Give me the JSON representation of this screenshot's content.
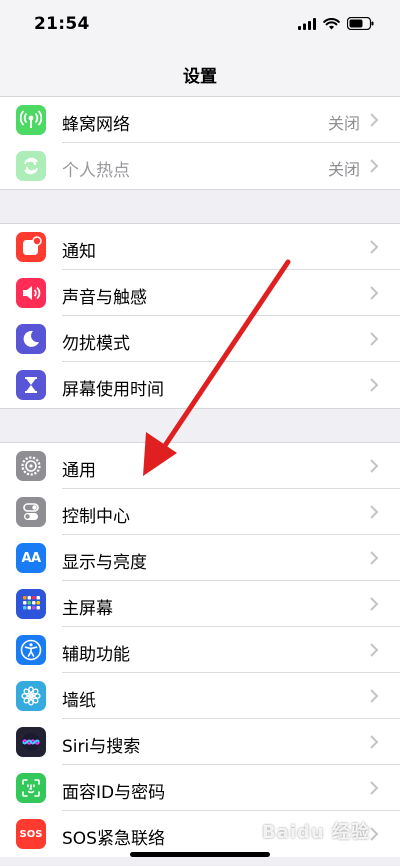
{
  "status": {
    "time": "21:54"
  },
  "nav": {
    "title": "设置"
  },
  "group1": [
    {
      "label": "蜂窝网络",
      "value": "关闭",
      "icon": "antenna-icon",
      "color": "#4cd964"
    },
    {
      "label": "个人热点",
      "value": "关闭",
      "icon": "hotspot-icon",
      "color": "#4cd964"
    }
  ],
  "group2": [
    {
      "label": "通知",
      "icon": "notifications-icon",
      "color": "#ff3b30"
    },
    {
      "label": "声音与触感",
      "icon": "sound-icon",
      "color": "#ff2d55"
    },
    {
      "label": "勿扰模式",
      "icon": "moon-icon",
      "color": "#5856d6"
    },
    {
      "label": "屏幕使用时间",
      "icon": "hourglass-icon",
      "color": "#5856d6"
    }
  ],
  "group3": [
    {
      "label": "通用",
      "icon": "gear-icon",
      "color": "#8e8e93"
    },
    {
      "label": "控制中心",
      "icon": "toggles-icon",
      "color": "#8e8e93"
    },
    {
      "label": "显示与亮度",
      "icon": "text-size-icon",
      "color": "#1a7cf5"
    },
    {
      "label": "主屏幕",
      "icon": "home-grid-icon",
      "color": "#2c55d9"
    },
    {
      "label": "辅助功能",
      "icon": "accessibility-icon",
      "color": "#1a7cf5"
    },
    {
      "label": "墙纸",
      "icon": "flower-icon",
      "color": "#35aadc"
    },
    {
      "label": "Siri与搜索",
      "icon": "siri-icon",
      "color": "#222233"
    },
    {
      "label": "面容ID与密码",
      "icon": "face-id-icon",
      "color": "#34c759"
    },
    {
      "label": "SOS紧急联络",
      "icon": "sos-icon",
      "color": "#ff3b30"
    }
  ],
  "icons": {
    "sos_text": "SOS",
    "display_text": "AA"
  },
  "watermark": "Baidu 经验"
}
